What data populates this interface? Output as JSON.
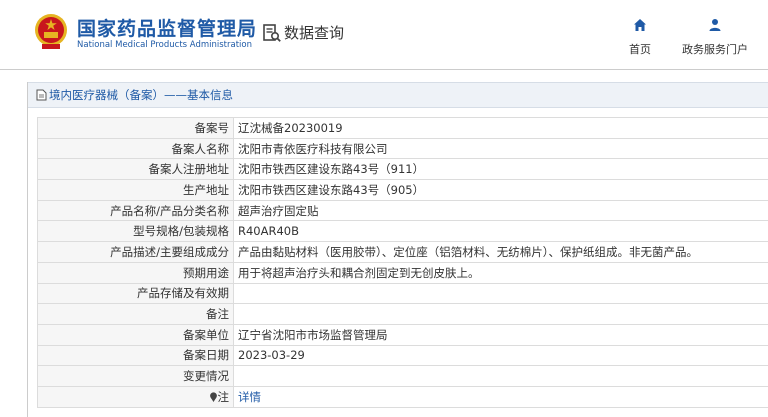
{
  "header": {
    "org_name_cn": "国家药品监督管理局",
    "org_name_en": "National Medical Products Administration",
    "query_label": "数据查询",
    "nav": [
      {
        "label": "首页",
        "icon": "home-icon"
      },
      {
        "label": "政务服务门户",
        "icon": "user-icon"
      }
    ]
  },
  "section": {
    "title": "境内医疗器械（备案）——基本信息"
  },
  "rows": [
    {
      "label": "备案号",
      "value": "辽沈械备20230019"
    },
    {
      "label": "备案人名称",
      "value": "沈阳市青依医疗科技有限公司"
    },
    {
      "label": "备案人注册地址",
      "value": "沈阳市铁西区建设东路43号（911）"
    },
    {
      "label": "生产地址",
      "value": "沈阳市铁西区建设东路43号（905）"
    },
    {
      "label": "产品名称/产品分类名称",
      "value": "超声治疗固定贴"
    },
    {
      "label": "型号规格/包装规格",
      "value": "R40AR40B"
    },
    {
      "label": "产品描述/主要组成成分",
      "value": "产品由黏贴材料（医用胶带）、定位座（铝箔材料、无纺棉片）、保护纸组成。非无菌产品。"
    },
    {
      "label": "预期用途",
      "value": "用于将超声治疗头和耦合剂固定到无创皮肤上。"
    },
    {
      "label": "产品存储及有效期",
      "value": ""
    },
    {
      "label": "备注",
      "value": ""
    },
    {
      "label": "备案单位",
      "value": "辽宁省沈阳市市场监督管理局"
    },
    {
      "label": "备案日期",
      "value": "2023-03-29"
    },
    {
      "label": "变更情况",
      "value": ""
    },
    {
      "label": "注",
      "value": "详情"
    }
  ],
  "colors": {
    "brand_blue": "#1f5aa6",
    "emblem_red": "#c8161d",
    "emblem_gold": "#e6b422"
  }
}
